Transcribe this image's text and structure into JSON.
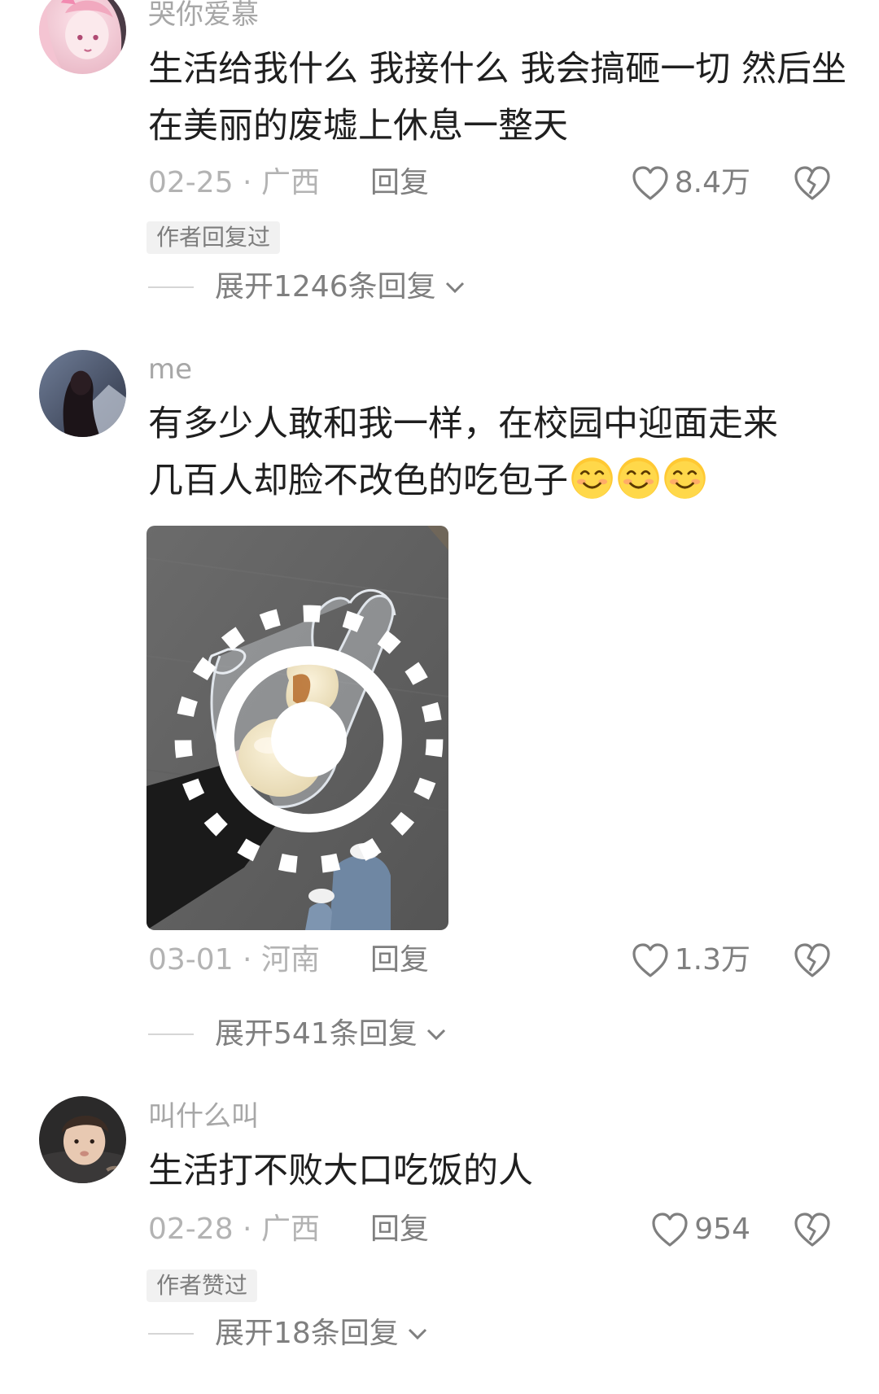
{
  "comments": [
    {
      "username": "哭你爱慕",
      "avatar_icon": "anime-girl-avatar",
      "text": "生活给我什么 我接什么 我会搞砸一切 然后坐在美丽的废墟上休息一整天",
      "date_location": "02-25 · 广西",
      "reply_label": "回复",
      "likes": "8.4万",
      "tag": "作者回复过",
      "expand_label": "展开1246条回复"
    },
    {
      "username": "me",
      "avatar_icon": "hooded-figure-avatar",
      "text": "有多少人敢和我一样，在校园中迎面走来几百人却脸不改色的吃包子",
      "emoji_icons": [
        "smiling-face-icon",
        "smiling-face-icon",
        "smiling-face-icon"
      ],
      "image_description_icon": "steamed-bun-in-plastic-bag-photo",
      "date_location": "03-01 · 河南",
      "reply_label": "回复",
      "likes": "1.3万",
      "expand_label": "展开541条回复"
    },
    {
      "username": "叫什么叫",
      "avatar_icon": "young-person-avatar",
      "text": "生活打不败大口吃饭的人",
      "date_location": "02-28 · 广西",
      "reply_label": "回复",
      "likes": "954",
      "tag": "作者赞过",
      "expand_label": "展开18条回复"
    }
  ],
  "colors": {
    "text_primary": "#1f1f1f",
    "text_muted": "#a7a7a7",
    "text_secondary": "#7f7f7f",
    "tag_bg": "#f1f1f1"
  }
}
